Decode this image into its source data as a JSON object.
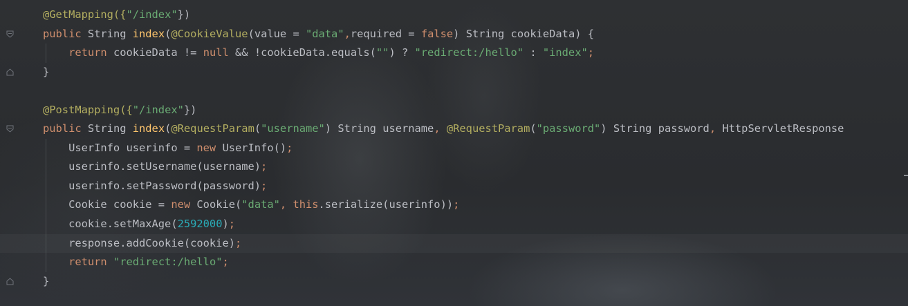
{
  "editor": {
    "lines": [
      [
        {
          "t": "@GetMapping({",
          "c": "ann"
        },
        {
          "t": "\"/index\"",
          "c": "str"
        },
        {
          "t": "})",
          "c": "plain"
        }
      ],
      [
        {
          "t": "public ",
          "c": "kw"
        },
        {
          "t": "String ",
          "c": "ty"
        },
        {
          "t": "index",
          "c": "fn"
        },
        {
          "t": "(",
          "c": "plain"
        },
        {
          "t": "@CookieValue",
          "c": "ann"
        },
        {
          "t": "(value = ",
          "c": "plain"
        },
        {
          "t": "\"data\"",
          "c": "str"
        },
        {
          "t": ",",
          "c": "kw"
        },
        {
          "t": "required = ",
          "c": "plain"
        },
        {
          "t": "false",
          "c": "kw"
        },
        {
          "t": ") String cookieData) {",
          "c": "plain"
        }
      ],
      [
        {
          "t": "    ",
          "c": "plain"
        },
        {
          "t": "return ",
          "c": "kw"
        },
        {
          "t": "cookieData != ",
          "c": "plain"
        },
        {
          "t": "null ",
          "c": "kw"
        },
        {
          "t": "&& !cookieData.equals(",
          "c": "plain"
        },
        {
          "t": "\"\"",
          "c": "str"
        },
        {
          "t": ") ? ",
          "c": "plain"
        },
        {
          "t": "\"redirect:/hello\"",
          "c": "str"
        },
        {
          "t": " : ",
          "c": "plain"
        },
        {
          "t": "\"index\"",
          "c": "str"
        },
        {
          "t": ";",
          "c": "kw"
        }
      ],
      [
        {
          "t": "}",
          "c": "plain"
        }
      ],
      [],
      [
        {
          "t": "@PostMapping({",
          "c": "ann"
        },
        {
          "t": "\"/index\"",
          "c": "str"
        },
        {
          "t": "})",
          "c": "plain"
        }
      ],
      [
        {
          "t": "public ",
          "c": "kw"
        },
        {
          "t": "String ",
          "c": "ty"
        },
        {
          "t": "index",
          "c": "fn"
        },
        {
          "t": "(",
          "c": "plain"
        },
        {
          "t": "@RequestParam",
          "c": "ann"
        },
        {
          "t": "(",
          "c": "plain"
        },
        {
          "t": "\"username\"",
          "c": "str"
        },
        {
          "t": ") String username",
          "c": "plain"
        },
        {
          "t": ", ",
          "c": "kw"
        },
        {
          "t": "@RequestParam",
          "c": "ann"
        },
        {
          "t": "(",
          "c": "plain"
        },
        {
          "t": "\"password\"",
          "c": "str"
        },
        {
          "t": ") String password",
          "c": "plain"
        },
        {
          "t": ", ",
          "c": "kw"
        },
        {
          "t": "HttpServletResponse",
          "c": "plain"
        }
      ],
      [
        {
          "t": "    UserInfo userinfo = ",
          "c": "plain"
        },
        {
          "t": "new ",
          "c": "kw"
        },
        {
          "t": "UserInfo()",
          "c": "plain"
        },
        {
          "t": ";",
          "c": "kw"
        }
      ],
      [
        {
          "t": "    userinfo.setUsername(username)",
          "c": "plain"
        },
        {
          "t": ";",
          "c": "kw"
        }
      ],
      [
        {
          "t": "    userinfo.setPassword(password)",
          "c": "plain"
        },
        {
          "t": ";",
          "c": "kw"
        }
      ],
      [
        {
          "t": "    Cookie cookie = ",
          "c": "plain"
        },
        {
          "t": "new ",
          "c": "kw"
        },
        {
          "t": "Cookie(",
          "c": "plain"
        },
        {
          "t": "\"data\"",
          "c": "str"
        },
        {
          "t": ", ",
          "c": "kw"
        },
        {
          "t": "this",
          "c": "kw"
        },
        {
          "t": ".serialize(userinfo))",
          "c": "plain"
        },
        {
          "t": ";",
          "c": "kw"
        }
      ],
      [
        {
          "t": "    cookie.setMaxAge(",
          "c": "plain"
        },
        {
          "t": "2592000",
          "c": "num"
        },
        {
          "t": ")",
          "c": "plain"
        },
        {
          "t": ";",
          "c": "kw"
        }
      ],
      [
        {
          "t": "    response.addCookie(cookie)",
          "c": "plain"
        },
        {
          "t": ";",
          "c": "kw"
        }
      ],
      [
        {
          "t": "    ",
          "c": "plain"
        },
        {
          "t": "return ",
          "c": "kw"
        },
        {
          "t": "\"redirect:/hello\"",
          "c": "str"
        },
        {
          "t": ";",
          "c": "kw"
        }
      ],
      [
        {
          "t": "}",
          "c": "plain"
        }
      ]
    ],
    "current_line": 12,
    "fold_markers": [
      {
        "line": 1,
        "icon": "fold-start-icon"
      },
      {
        "line": 3,
        "icon": "fold-end-icon"
      },
      {
        "line": 6,
        "icon": "fold-start-icon"
      },
      {
        "line": 14,
        "icon": "fold-end-icon"
      }
    ]
  }
}
